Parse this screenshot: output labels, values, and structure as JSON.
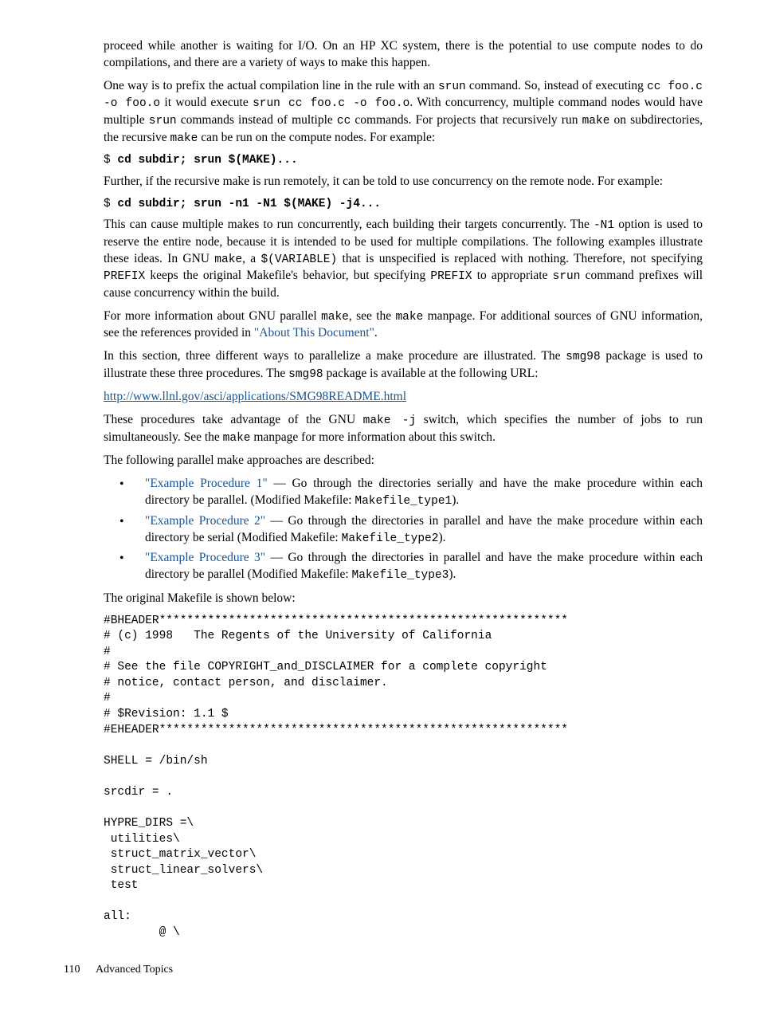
{
  "paragraphs": {
    "p1a": "proceed while another is waiting for I/O. On an HP XC system, there is the potential to use compute nodes to do compilations, and there are a variety of ways to make this happen.",
    "p2_pre": "One way is to prefix the actual compilation line in the rule with an ",
    "p2_c1": "srun",
    "p2_mid1": " command. So, instead of executing ",
    "p2_c2": "cc foo.c -o foo.o",
    "p2_mid2": " it would execute ",
    "p2_c3": "srun cc foo.c -o foo.o",
    "p2_mid3": ". With concurrency, multiple command nodes would have multiple ",
    "p2_c4": "srun",
    "p2_mid4": " commands instead of multiple ",
    "p2_c5": "cc",
    "p2_mid5": " commands. For projects that recursively run ",
    "p2_c6": "make",
    "p2_mid6": " on subdirectories, the recursive ",
    "p2_c7": "make",
    "p2_end": " can be run on the compute nodes. For example:",
    "cmd1_prompt": "$ ",
    "cmd1_bold": "cd subdir; srun $(MAKE)...",
    "p3": "Further, if the recursive make is run remotely, it can be told to use concurrency on the remote node. For example:",
    "cmd2_prompt": "$ ",
    "cmd2_bold": "cd subdir; srun -n1 -N1 $(MAKE) -j4...",
    "p4_pre": "This can cause multiple makes to run concurrently, each building their targets concurrently. The ",
    "p4_c1": "-N1",
    "p4_mid1": " option is used to reserve the entire node, because it is intended to be used for multiple compilations. The following examples illustrate these ideas. In GNU ",
    "p4_c2": "make",
    "p4_mid2": ", a ",
    "p4_c3": "$(VARIABLE)",
    "p4_mid3": " that is unspecified is replaced with nothing. Therefore, not specifying ",
    "p4_c4": "PREFIX",
    "p4_mid4": " keeps the original Makefile's behavior, but specifying ",
    "p4_c5": "PREFIX",
    "p4_mid5": " to appropriate ",
    "p4_c6": "srun",
    "p4_end": " command prefixes will cause concurrency within the build.",
    "p5_pre": "For more information about GNU parallel ",
    "p5_c1": "make",
    "p5_mid1": ", see the ",
    "p5_c2": "make",
    "p5_mid2": " manpage. For additional sources of GNU information, see the references provided in ",
    "p5_link": "\"About This Document\"",
    "p5_end": ".",
    "p6_pre": "In this section, three different ways to parallelize a make procedure are illustrated. The ",
    "p6_c1": "smg98",
    "p6_mid1": " package is used to illustrate these three procedures. The ",
    "p6_c2": "smg98",
    "p6_end": " package is available at the following URL:",
    "url": "http://www.llnl.gov/asci/applications/SMG98README.html",
    "p7_pre": "These procedures take advantage of the GNU ",
    "p7_c1": "make -j",
    "p7_mid1": " switch, which specifies the number of jobs to run simultaneously. See the ",
    "p7_c2": "make",
    "p7_end": " manpage for more information about this switch.",
    "p8": "The following parallel make approaches are described:",
    "p9": "The original Makefile is shown below:"
  },
  "bullets": [
    {
      "link": "\"Example Procedure 1\"",
      "text": " — Go through the directories serially and have the make procedure within each directory be parallel. (Modified Makefile: ",
      "code": "Makefile_type1",
      "end": ")."
    },
    {
      "link": "\"Example Procedure 2\"",
      "text": " — Go through the directories in parallel and have the make procedure within each directory be serial (Modified Makefile: ",
      "code": "Makefile_type2",
      "end": ")."
    },
    {
      "link": "\"Example Procedure 3\"",
      "text": " — Go through the directories in parallel and have the make procedure within each directory be parallel (Modified Makefile: ",
      "code": "Makefile_type3",
      "end": ")."
    }
  ],
  "codeblock": "#BHEADER***********************************************************\n# (c) 1998   The Regents of the University of California\n#\n# See the file COPYRIGHT_and_DISCLAIMER for a complete copyright\n# notice, contact person, and disclaimer.\n#\n# $Revision: 1.1 $\n#EHEADER***********************************************************\n\nSHELL = /bin/sh\n\nsrcdir = .\n\nHYPRE_DIRS =\\\n utilities\\\n struct_matrix_vector\\\n struct_linear_solvers\\\n test\n\nall:\n        @ \\",
  "footer": {
    "page": "110",
    "title": "Advanced Topics"
  }
}
